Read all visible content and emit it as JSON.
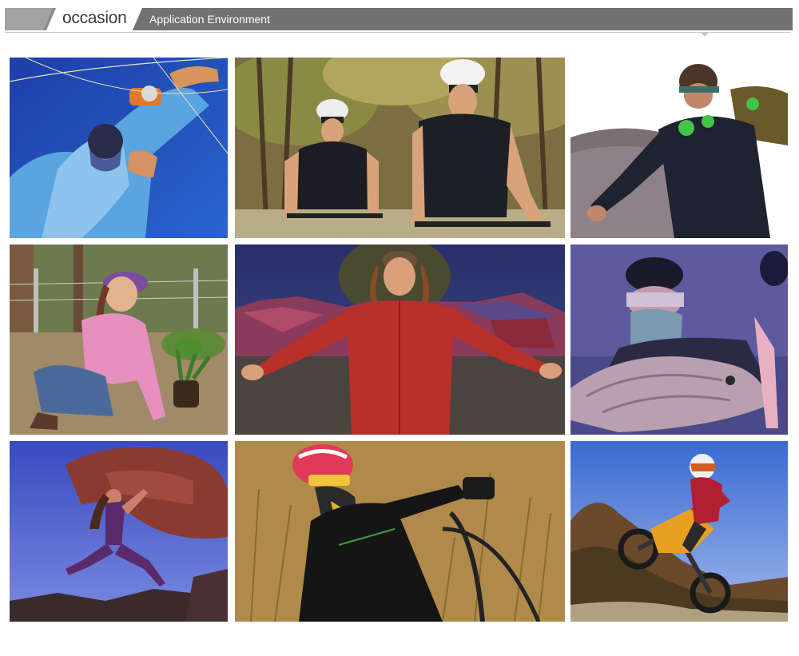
{
  "header": {
    "title": "occasion",
    "subtitle": "Application Environment"
  },
  "colors": {
    "banner_dark": "#6e6e6e",
    "banner_light": "#9b9b9b",
    "title_bg": "#ffffff",
    "divider": "#c9c9c9"
  }
}
